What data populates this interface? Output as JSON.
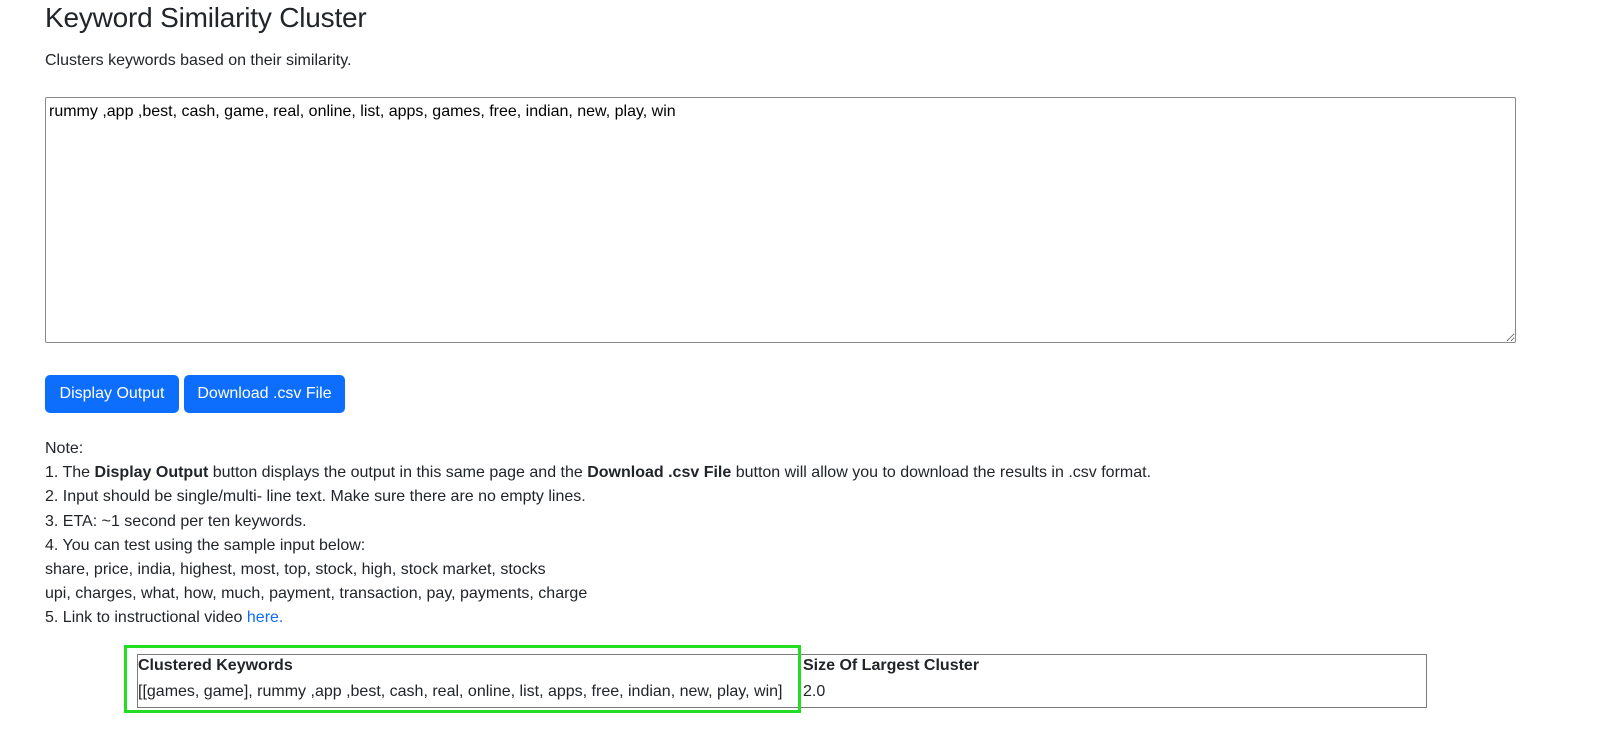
{
  "page": {
    "title": "Keyword Similarity Cluster",
    "subtitle": "Clusters keywords based on their similarity."
  },
  "input": {
    "value": "rummy ,app ,best, cash, game, real, online, list, apps, games, free, indian, new, play, win"
  },
  "buttons": {
    "display_label": "Display Output",
    "download_label": "Download .csv File"
  },
  "notes": {
    "heading": "Note:",
    "item1_prefix": "1. The ",
    "item1_bold1": "Display Output",
    "item1_mid": " button displays the output in this same page and the ",
    "item1_bold2": "Download .csv File",
    "item1_suffix": " button will allow you to download the results in .csv format.",
    "item2": "2. Input should be single/multi- line text. Make sure there are no empty lines.",
    "item3": "3. ETA: ~1 second per ten keywords.",
    "item4": "4. You can test using the sample input below:",
    "sample1": "share, price, india, highest, most, top, stock, high, stock market, stocks",
    "sample2": "upi, charges, what, how, much, payment, transaction, pay, payments, charge",
    "item5_prefix": "5. Link to instructional video ",
    "item5_link": "here."
  },
  "results": {
    "headers": [
      "Clustered Keywords",
      "Size Of Largest Cluster"
    ],
    "rows": [
      [
        "[[games, game], rummy ,app ,best, cash, real, online, list, apps, free, indian, new, play, win]",
        "2.0"
      ]
    ]
  },
  "colors": {
    "accent": "#0d6efd",
    "highlight": "#22dd22"
  }
}
